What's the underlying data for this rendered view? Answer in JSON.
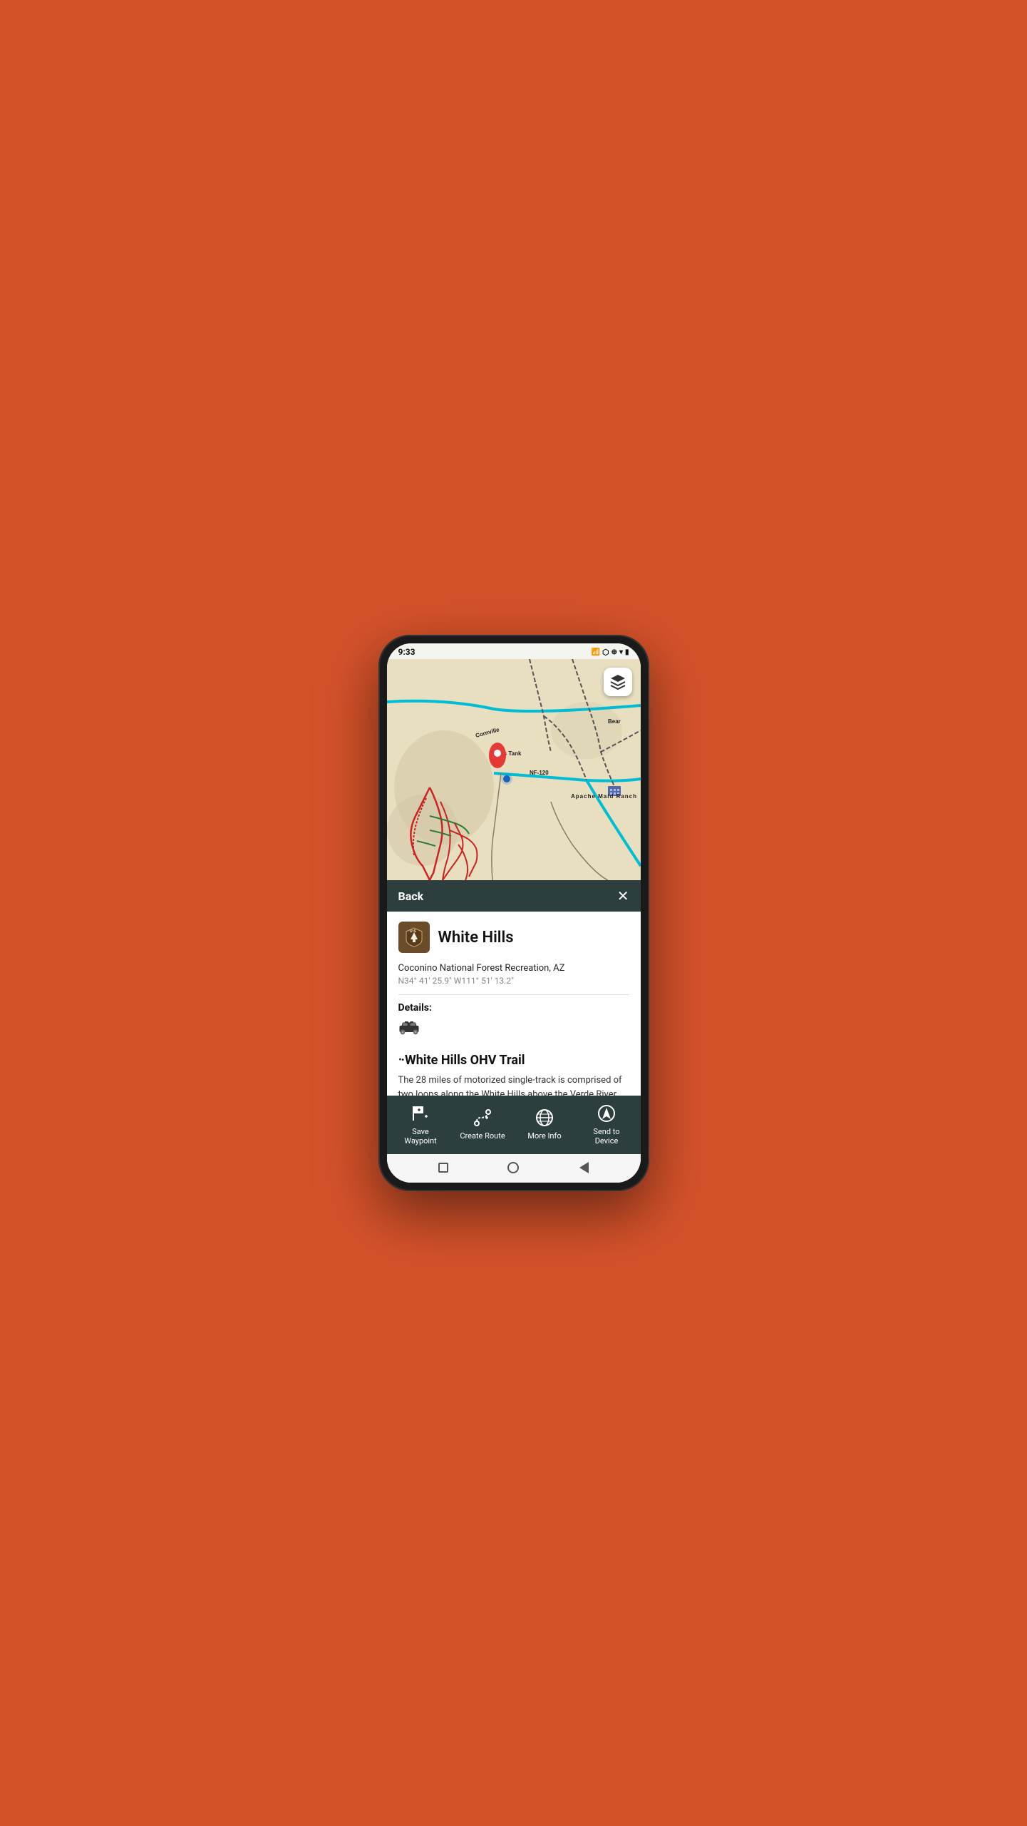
{
  "status_bar": {
    "time": "9:33",
    "icons": [
      "signal",
      "bluetooth",
      "location",
      "wifi",
      "no-signal1",
      "no-signal2",
      "battery"
    ]
  },
  "map": {
    "layer_button_label": "layers"
  },
  "panel_header": {
    "back_label": "Back",
    "close_label": "✕"
  },
  "place": {
    "name": "White Hills",
    "region": "Coconino National Forest Recreation, AZ",
    "coords": "N34° 41' 25.9\" W111° 51' 13.2\"",
    "logo_alt": "US Forest Service",
    "details_label": "Details:",
    "trail_title": "·White Hills OHV Trail",
    "trail_description": "The 28 miles of motorized single-track is comprised of two loops along the White Hills above the Verde River."
  },
  "toolbar": {
    "items": [
      {
        "id": "save-waypoint",
        "icon": "waypoint",
        "label": "Save\nWaypoint"
      },
      {
        "id": "create-route",
        "icon": "route",
        "label": "Create Route"
      },
      {
        "id": "more-info",
        "icon": "globe",
        "label": "More Info"
      },
      {
        "id": "send-to-device",
        "icon": "navigate",
        "label": "Send to\nDevice"
      }
    ]
  },
  "android_nav": {
    "square_label": "recents",
    "circle_label": "home",
    "triangle_label": "back"
  }
}
